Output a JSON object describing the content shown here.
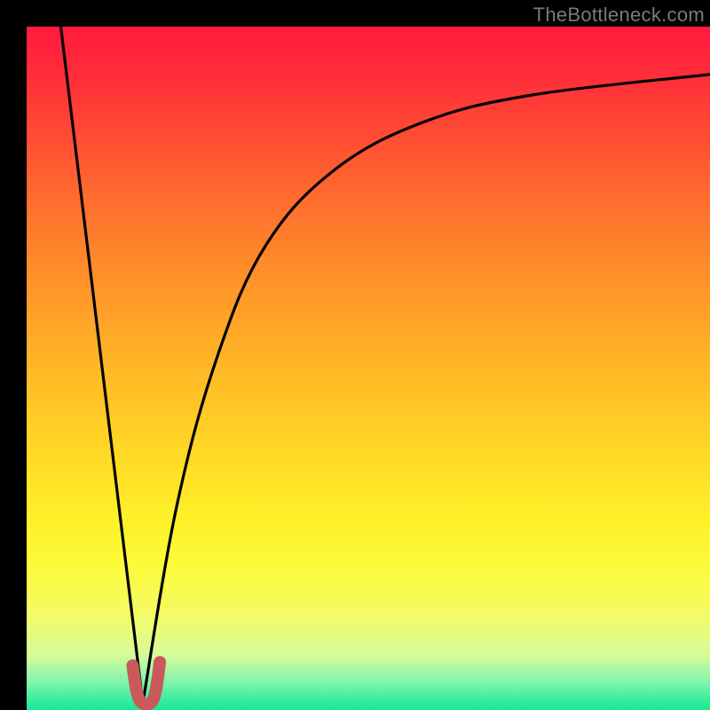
{
  "watermark": "TheBottleneck.com",
  "chart_data": {
    "type": "line",
    "title": "",
    "xlabel": "",
    "ylabel": "",
    "xlim": [
      0,
      100
    ],
    "ylim": [
      0,
      100
    ],
    "comment": "y is bottleneck % (0 = bottom green, 100 = top red). x is normalized config axis. Background encodes severity from green (near 0) to red (near 100).",
    "series": [
      {
        "name": "left-falling-line",
        "x": [
          5,
          17
        ],
        "y": [
          100,
          1
        ]
      },
      {
        "name": "right-rising-curve",
        "x": [
          17,
          22,
          28,
          35,
          45,
          58,
          74,
          100
        ],
        "y": [
          1,
          30,
          52,
          68,
          79,
          86,
          90,
          93
        ]
      },
      {
        "name": "marker-hook",
        "x": [
          15.5,
          16.5,
          18.5,
          19.5
        ],
        "y": [
          6.5,
          1.5,
          1.5,
          7.0
        ]
      }
    ],
    "colors": {
      "curve": "#000000",
      "marker": "#c85a5a",
      "gradient_top": "#ff1a3f",
      "gradient_mid": "#fff028",
      "gradient_bottom": "#1de78e"
    }
  }
}
